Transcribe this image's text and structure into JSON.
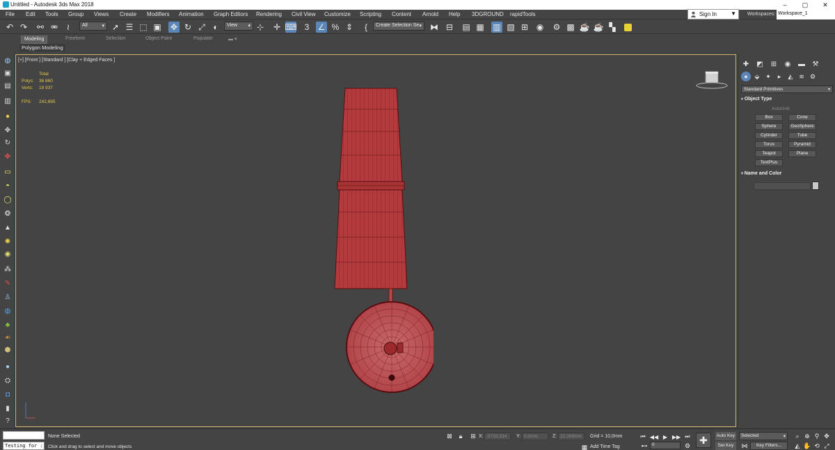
{
  "title_bar": {
    "title": "Untitled - Autodesk 3ds Max 2018",
    "minimize": "–",
    "maximize": "▢",
    "close": "✕"
  },
  "menu": [
    "File",
    "Edit",
    "Tools",
    "Group",
    "Views",
    "Create",
    "Modifiers",
    "Animation",
    "Graph Editors",
    "Rendering",
    "Civil View",
    "Customize",
    "Scripting",
    "Content",
    "Arnold",
    "Help",
    "3DGROUND",
    "rapidTools"
  ],
  "sign_in": "Sign In",
  "workspaces": {
    "label": "Workspaces:",
    "value": "Workspace_1"
  },
  "toolbar": {
    "selection_filter": "All",
    "ref_coord": "View",
    "snap_value": "3",
    "named_selection": "Create Selection Se"
  },
  "ribbon": {
    "tabs": [
      "Modeling",
      "Freeform",
      "Selection",
      "Object Paint",
      "Populate"
    ],
    "active_tab": "Modeling",
    "panel": "Polygon Modeling"
  },
  "viewport": {
    "label": "[+] [Front ] [Standard ] [Clay + Edged Faces ]",
    "stats": {
      "total_label": "Total",
      "polys_label": "Polys:",
      "polys_value": "36 860",
      "verts_label": "Verts:",
      "verts_value": "19 937",
      "fps_label": "FPS:",
      "fps_value": "242,895"
    }
  },
  "command_panel": {
    "category": "Standard Primitives",
    "object_type_title": "Object Type",
    "autogrid": "AutoGrid",
    "buttons": [
      "Box",
      "Cone",
      "Sphere",
      "GeoSphere",
      "Cylinder",
      "Tube",
      "Torus",
      "Pyramid",
      "Teapot",
      "Plane",
      "TextPlus"
    ],
    "name_color_title": "Name and Color"
  },
  "status": {
    "script_listener": "Testing for :",
    "selection": "None Selected",
    "prompt": "Click and drag to select and move objects",
    "x_label": "X:",
    "x_value": "-5733,334",
    "y_label": "Y:",
    "y_value": "0,0mm",
    "z_label": "Z:",
    "z_value": "22,369mm",
    "grid": "Grid = 10,0mm",
    "add_time_tag": "Add Time Tag",
    "frame": "0",
    "auto_key": "Auto Key",
    "set_key": "Set Key",
    "key_mode": "Selected",
    "key_filters": "Key Filters..."
  },
  "colors": {
    "model_fill": "#b33b3d",
    "model_edge": "#5a0d10",
    "viewport_border": "#d6b46a",
    "stat_text": "#e8c84a",
    "active_button": "#5b86b8"
  }
}
